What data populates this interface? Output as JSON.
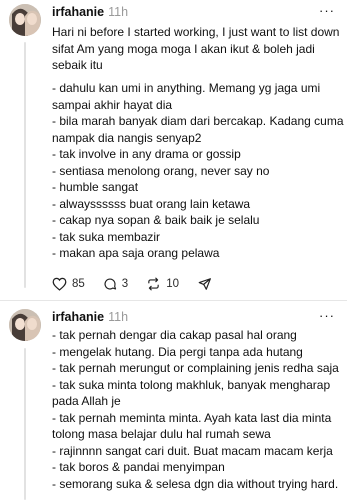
{
  "posts": [
    {
      "username": "irfahanie",
      "time": "11h",
      "lines": [
        "Hari ni before I started working, I just want to list down",
        "sifat Am yang moga moga I akan ikut & boleh jadi",
        "sebaik itu",
        "",
        "- dahulu kan umi in anything. Memang yg jaga umi",
        "sampai akhir hayat dia",
        "- bila marah banyak diam dari bercakap. Kadang cuma",
        "nampak dia nangis senyap2",
        "- tak involve in any drama or gossip",
        "- sentiasa menolong orang, never say no",
        "- humble sangat",
        "- alwayssssss buat orang lain ketawa",
        "- cakap nya sopan & baik baik je selalu",
        "- tak suka membazir",
        "- makan apa saja orang pelawa"
      ],
      "stats": {
        "likes": "85",
        "replies": "3",
        "reposts": "10"
      },
      "icons": {
        "like": "heart-icon",
        "reply": "comment-icon",
        "repost": "repost-icon",
        "share": "send-icon",
        "more": "more-icon"
      }
    },
    {
      "username": "irfahanie",
      "time": "11h",
      "lines": [
        "- tak pernah dengar dia cakap pasal hal orang",
        "- mengelak hutang. Dia pergi tanpa ada hutang",
        "- tak pernah merungut or complaining jenis redha saja",
        "- tak suka minta tolong makhluk, banyak mengharap",
        "pada Allah je",
        "- tak pernah meminta minta. Ayah kata last dia minta",
        "tolong masa belajar dulu hal rumah sewa",
        "- rajinnnn sangat cari duit. Buat macam macam kerja",
        "- tak boros & pandai menyimpan",
        "- semorang suka & selesa dgn dia without trying hard."
      ]
    }
  ],
  "more_glyph": "···"
}
